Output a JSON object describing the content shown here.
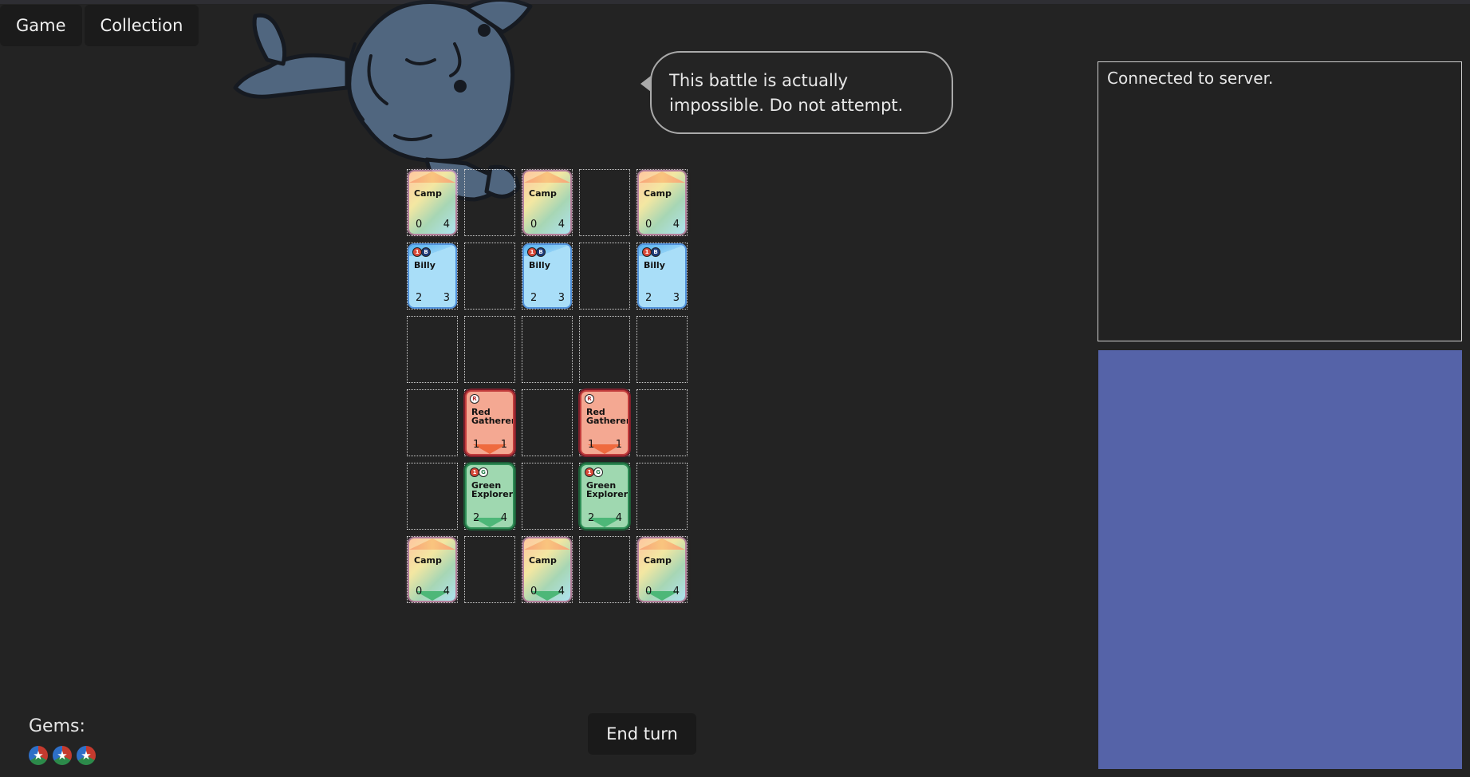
{
  "nav": {
    "game": "Game",
    "collection": "Collection"
  },
  "speech": "This battle is actually impossible. Do not attempt.",
  "board": [
    [
      {
        "type": "camp",
        "name": "Camp",
        "atk": "0",
        "hp": "4"
      },
      null,
      {
        "type": "camp",
        "name": "Camp",
        "atk": "0",
        "hp": "4"
      },
      null,
      {
        "type": "camp",
        "name": "Camp",
        "atk": "0",
        "hp": "4"
      }
    ],
    [
      {
        "type": "blue",
        "name": "Billy",
        "atk": "2",
        "hp": "3",
        "pips": [
          "1",
          "B"
        ]
      },
      null,
      {
        "type": "blue",
        "name": "Billy",
        "atk": "2",
        "hp": "3",
        "pips": [
          "1",
          "B"
        ]
      },
      null,
      {
        "type": "blue",
        "name": "Billy",
        "atk": "2",
        "hp": "3",
        "pips": [
          "1",
          "B"
        ]
      }
    ],
    [
      null,
      null,
      null,
      null,
      null
    ],
    [
      null,
      {
        "type": "red",
        "name": "Red Gatherer",
        "atk": "1",
        "hp": "1",
        "pips": [
          "R"
        ],
        "arrow": true
      },
      null,
      {
        "type": "red",
        "name": "Red Gatherer",
        "atk": "1",
        "hp": "1",
        "pips": [
          "R"
        ],
        "arrow": true
      },
      null
    ],
    [
      null,
      {
        "type": "green",
        "name": "Green Explorer",
        "atk": "2",
        "hp": "4",
        "pips": [
          "1",
          "G"
        ],
        "arrow": true
      },
      null,
      {
        "type": "green",
        "name": "Green Explorer",
        "atk": "2",
        "hp": "4",
        "pips": [
          "1",
          "G"
        ],
        "arrow": true
      },
      null
    ],
    [
      {
        "type": "camp",
        "name": "Camp",
        "atk": "0",
        "hp": "4",
        "arrow": true
      },
      null,
      {
        "type": "camp",
        "name": "Camp",
        "atk": "0",
        "hp": "4",
        "arrow": true
      },
      null,
      {
        "type": "camp",
        "name": "Camp",
        "atk": "0",
        "hp": "4",
        "arrow": true
      }
    ]
  ],
  "end_turn": "End turn",
  "gems": {
    "label": "Gems:",
    "count": 3,
    "icon": "star-gem-icon"
  },
  "log": {
    "text": "Connected to server."
  },
  "colors": {
    "background": "#232323",
    "panel": "#5563a8"
  }
}
